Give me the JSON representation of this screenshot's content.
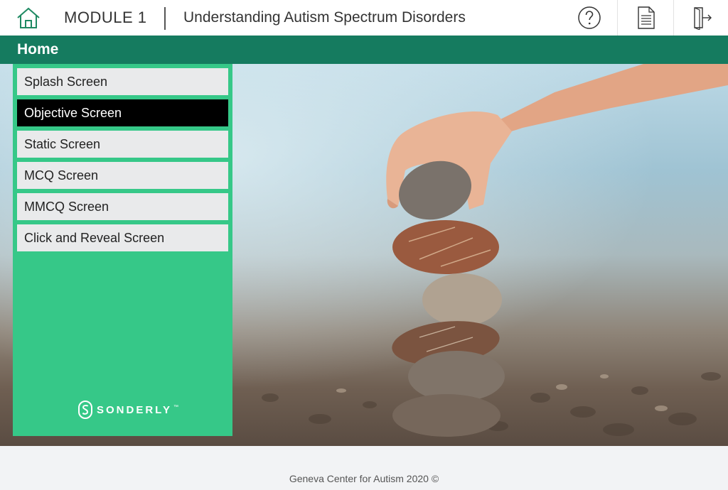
{
  "header": {
    "module_label": "MODULE 1",
    "module_title": "Understanding Autism Spectrum Disorders",
    "icons": [
      "home-icon",
      "help-icon",
      "document-icon",
      "exit-icon"
    ]
  },
  "section": {
    "title": "Home"
  },
  "menu": {
    "items": [
      {
        "label": "Splash Screen",
        "active": false
      },
      {
        "label": "Objective Screen",
        "active": true
      },
      {
        "label": "Static Screen",
        "active": false
      },
      {
        "label": "MCQ Screen",
        "active": false
      },
      {
        "label": "MMCQ Screen",
        "active": false
      },
      {
        "label": "Click and Reveal Screen",
        "active": false
      }
    ],
    "brand": "SONDERLY",
    "brand_tm": "™"
  },
  "footer": {
    "text": "Geneva Center for Autism 2020 ©"
  },
  "colors": {
    "header_green": "#157b5f",
    "menu_green": "#36c888",
    "active_item": "#000000",
    "icon_green": "#1f8a63"
  }
}
